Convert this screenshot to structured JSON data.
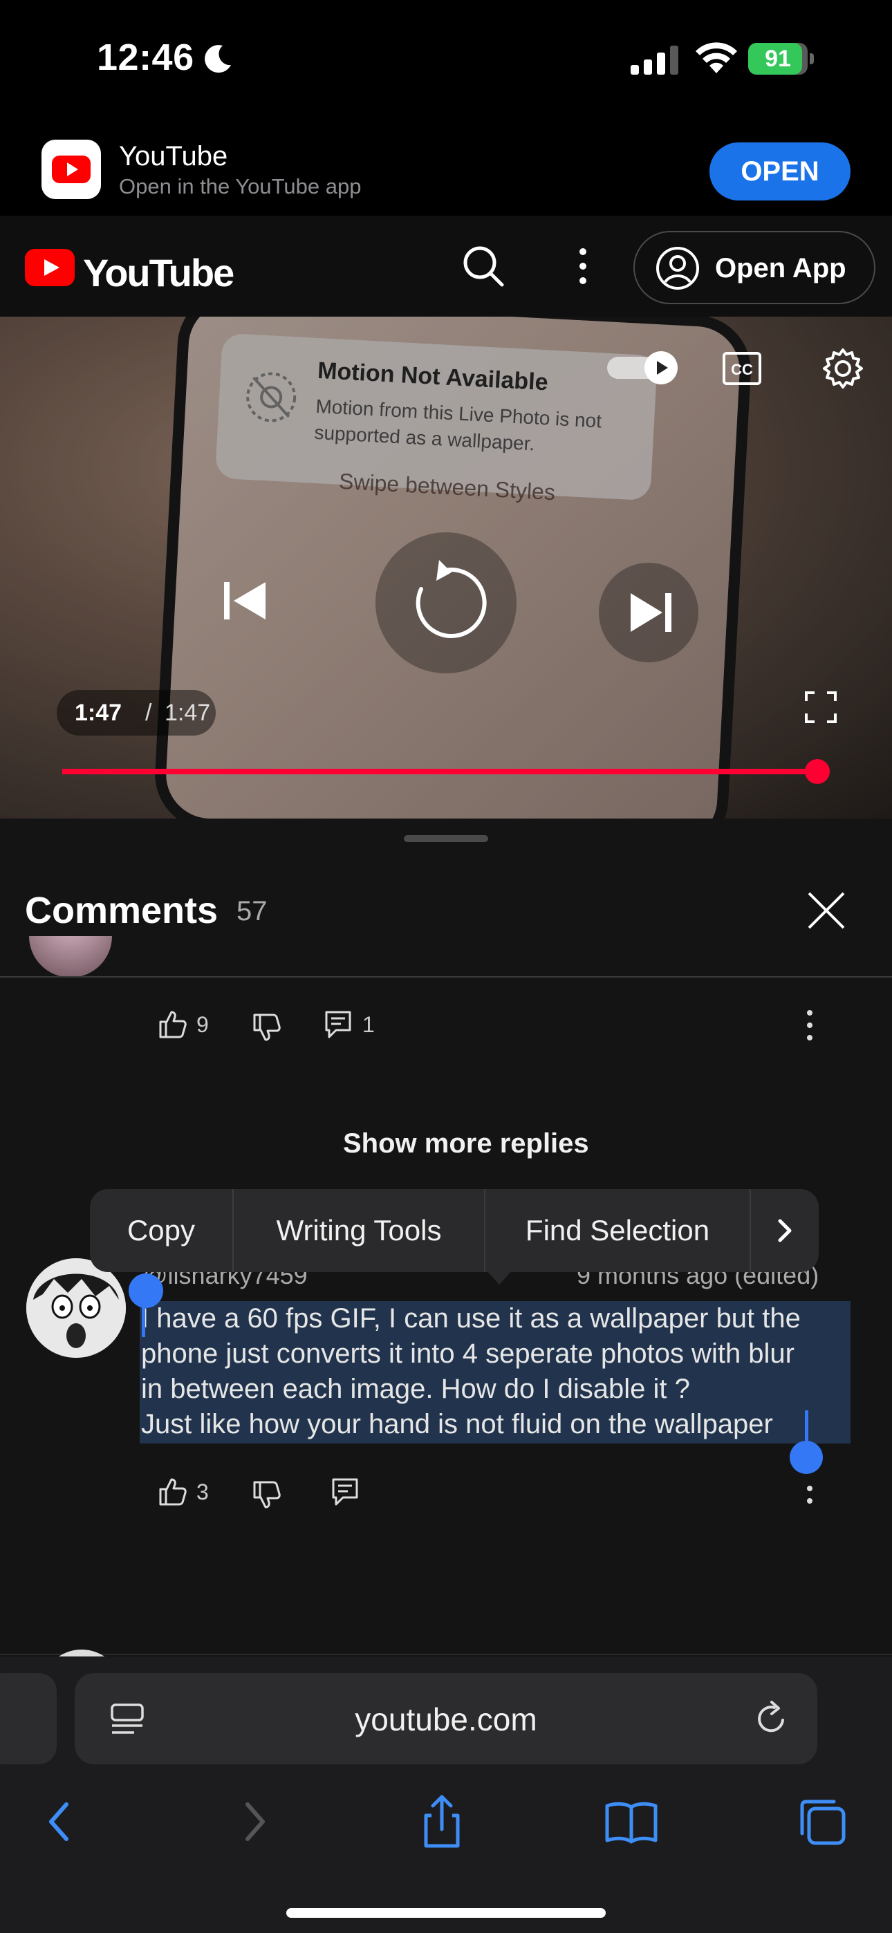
{
  "status": {
    "time": "12:46",
    "battery_label": "91",
    "battery_level": 0.91,
    "icons": [
      "moon-icon",
      "signal-icon",
      "wifi-icon",
      "battery-icon"
    ]
  },
  "banner": {
    "title": "YouTube",
    "subtitle": "Open in the YouTube app",
    "open_label": "OPEN",
    "accent": "#1a73e8"
  },
  "header": {
    "logo_text": "YouTube",
    "open_app_label": "Open App",
    "brand_red": "#ff0000"
  },
  "video": {
    "popup_title": "Motion Not Available",
    "popup_text": "Motion from this Live Photo is not supported as a wallpaper.",
    "swipe_text": "Swipe between Styles",
    "cc_label": "CC",
    "current_time": "1:47",
    "separator": "/",
    "duration": "1:47",
    "progress": 1.0,
    "progress_color": "#ff0033"
  },
  "comments": {
    "title": "Comments",
    "count": "57",
    "prev_comment": {
      "likes": "9",
      "replies": "1"
    },
    "show_more_replies": "Show more replies",
    "context_menu": {
      "items": [
        "Copy",
        "Writing Tools",
        "Find Selection"
      ],
      "more_icon": "chevron-right-icon"
    },
    "comment": {
      "author": "@llsharky7459",
      "meta": "9 months ago (edited)",
      "text_lines": [
        "I have a 60 fps GIF, I can use it as a wallpaper but the",
        "phone just converts it into 4 seperate photos with blur",
        "in between each image. How do I disable it ?",
        "Just like how your hand is not fluid on the wallpaper"
      ],
      "likes": "3"
    }
  },
  "browser": {
    "address": "youtube.com",
    "toolbar": [
      "back-icon",
      "forward-icon",
      "share-icon",
      "bookmarks-icon",
      "tabs-icon"
    ]
  }
}
